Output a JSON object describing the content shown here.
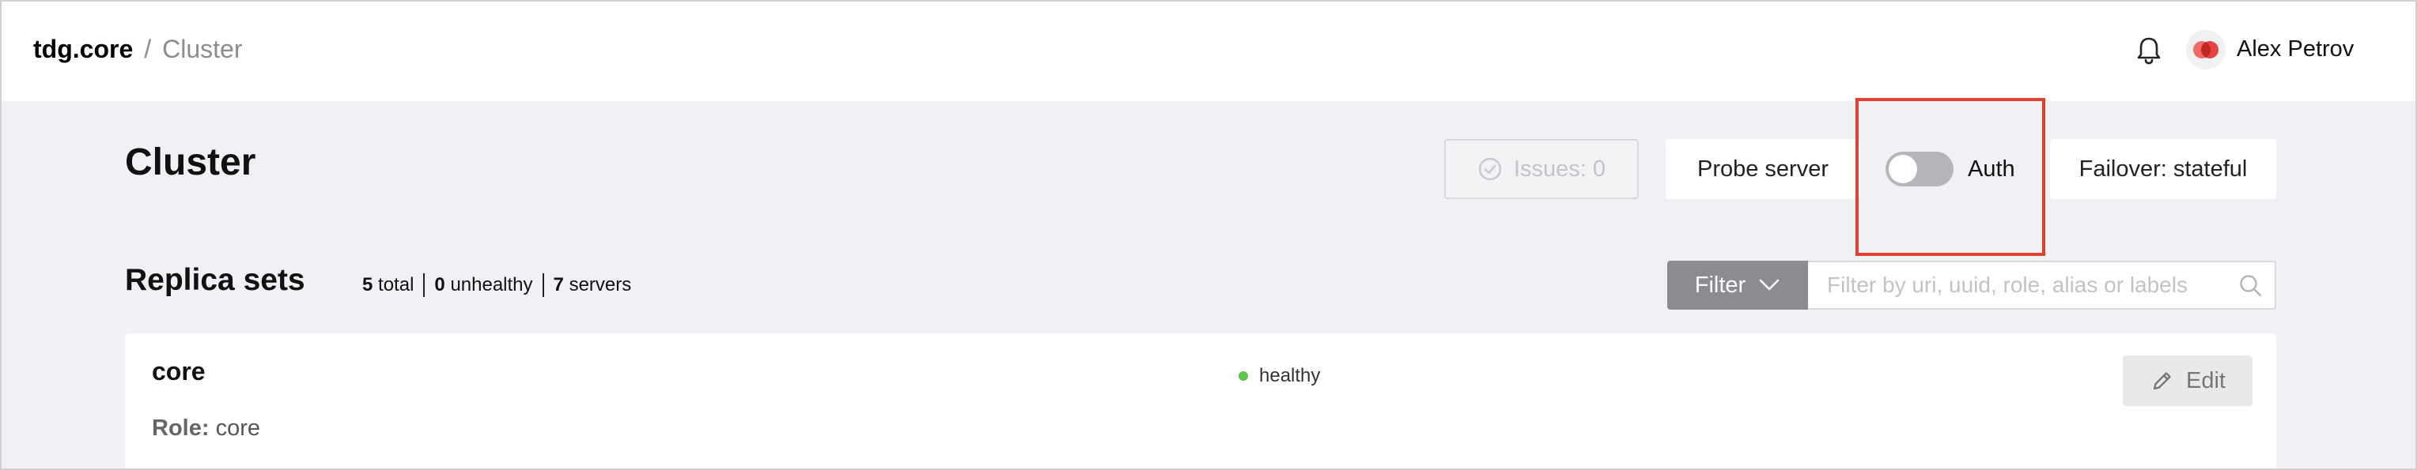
{
  "header": {
    "app_name": "tdg.core",
    "separator": "/",
    "page": "Cluster",
    "user_name": "Alex Petrov",
    "icons": [
      "bell-icon",
      "avatar-logo"
    ]
  },
  "toolbar": {
    "title": "Cluster",
    "issues_label": "Issues: 0",
    "probe_label": "Probe server",
    "auth_label": "Auth",
    "auth_enabled": false,
    "failover_label": "Failover: stateful"
  },
  "replica_sets": {
    "title": "Replica sets",
    "total_count": "5",
    "total_label": "total",
    "unhealthy_count": "0",
    "unhealthy_label": "unhealthy",
    "servers_count": "7",
    "servers_label": "servers",
    "filter_label": "Filter",
    "search_placeholder": "Filter by uri, uuid, role, alias or labels",
    "items": [
      {
        "name": "core",
        "status": "healthy",
        "role_label": "Role:",
        "role": "core",
        "edit_label": "Edit"
      }
    ]
  },
  "colors": {
    "highlight": "#e2412d",
    "healthy": "#5ec74a",
    "filter_button": "#8b8c92"
  }
}
